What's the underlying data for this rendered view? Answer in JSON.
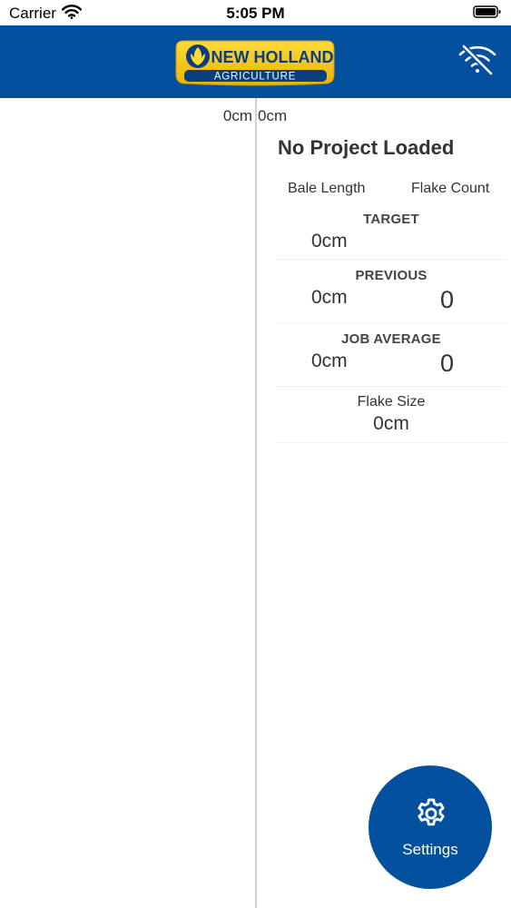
{
  "status_bar": {
    "carrier": "Carrier",
    "time": "5:05 PM",
    "wifi_icon": "wifi-icon",
    "battery_icon": "battery-full-icon"
  },
  "header": {
    "logo_line1": "NEW HOLLAND",
    "logo_line2": "AGRICULTURE",
    "offline_icon": "wifi-off-icon",
    "brand_color": "#02509e",
    "logo_color": "#f5c400"
  },
  "readouts": {
    "left": "0cm",
    "right": "0cm"
  },
  "panel": {
    "project_title": "No Project Loaded",
    "col_bale_length": "Bale Length",
    "col_flake_count": "Flake Count",
    "target": {
      "label": "TARGET",
      "length": "0cm"
    },
    "previous": {
      "label": "PREVIOUS",
      "length": "0cm",
      "count": "0"
    },
    "job_average": {
      "label": "JOB AVERAGE",
      "length": "0cm",
      "count": "0"
    },
    "flake_size": {
      "label": "Flake Size",
      "value": "0cm"
    }
  },
  "settings": {
    "label": "Settings",
    "icon": "gear-icon"
  }
}
